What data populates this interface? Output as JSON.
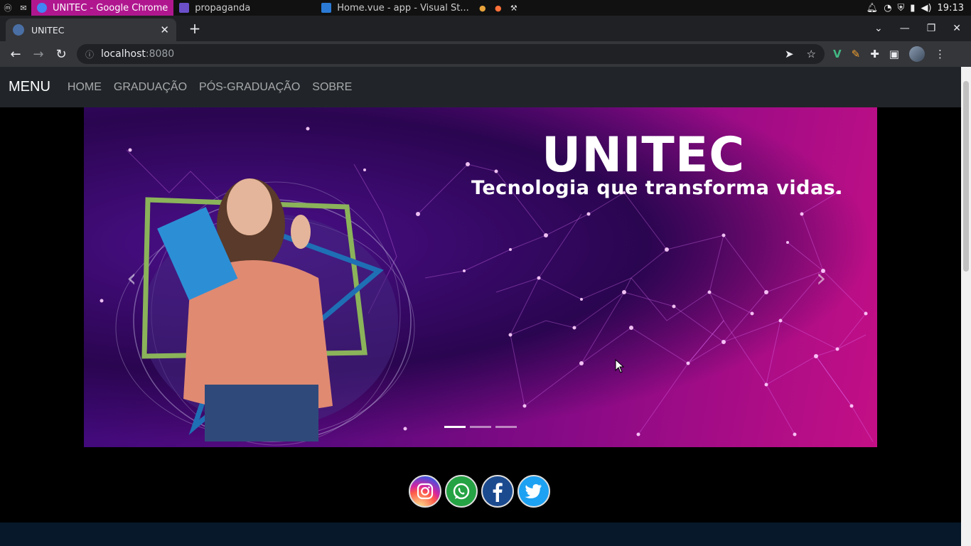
{
  "os_taskbar": {
    "tasks": [
      {
        "label": "UNITEC - Google Chrome",
        "active": true
      },
      {
        "label": "propaganda",
        "active": false
      },
      {
        "label": "Home.vue - app - Visual St...",
        "active": false
      }
    ],
    "clock": "19:13"
  },
  "browser": {
    "tab_title": "UNITEC",
    "url_host": "localhost",
    "url_port": ":8080"
  },
  "navbar": {
    "brand": "MENU",
    "links": [
      "HOME",
      "GRADUAÇÃO",
      "PÓS-GRADUAÇÃO",
      "SOBRE"
    ]
  },
  "hero": {
    "title": "UNITEC",
    "subtitle": "Tecnologia que transforma vidas.",
    "prev_icon": "chevron-left-icon",
    "next_icon": "chevron-right-icon",
    "slide_count": 3,
    "active_slide": 1
  },
  "social": [
    {
      "name": "instagram-icon",
      "color": "#d6249f"
    },
    {
      "name": "whatsapp-icon",
      "color": "#25a244"
    },
    {
      "name": "facebook-icon",
      "color": "#1b4a8f"
    },
    {
      "name": "twitter-icon",
      "color": "#1da1f2"
    }
  ],
  "colors": {
    "navbar_bg": "#212529",
    "footer_bg": "#07182b",
    "active_task": "#b0178f"
  }
}
